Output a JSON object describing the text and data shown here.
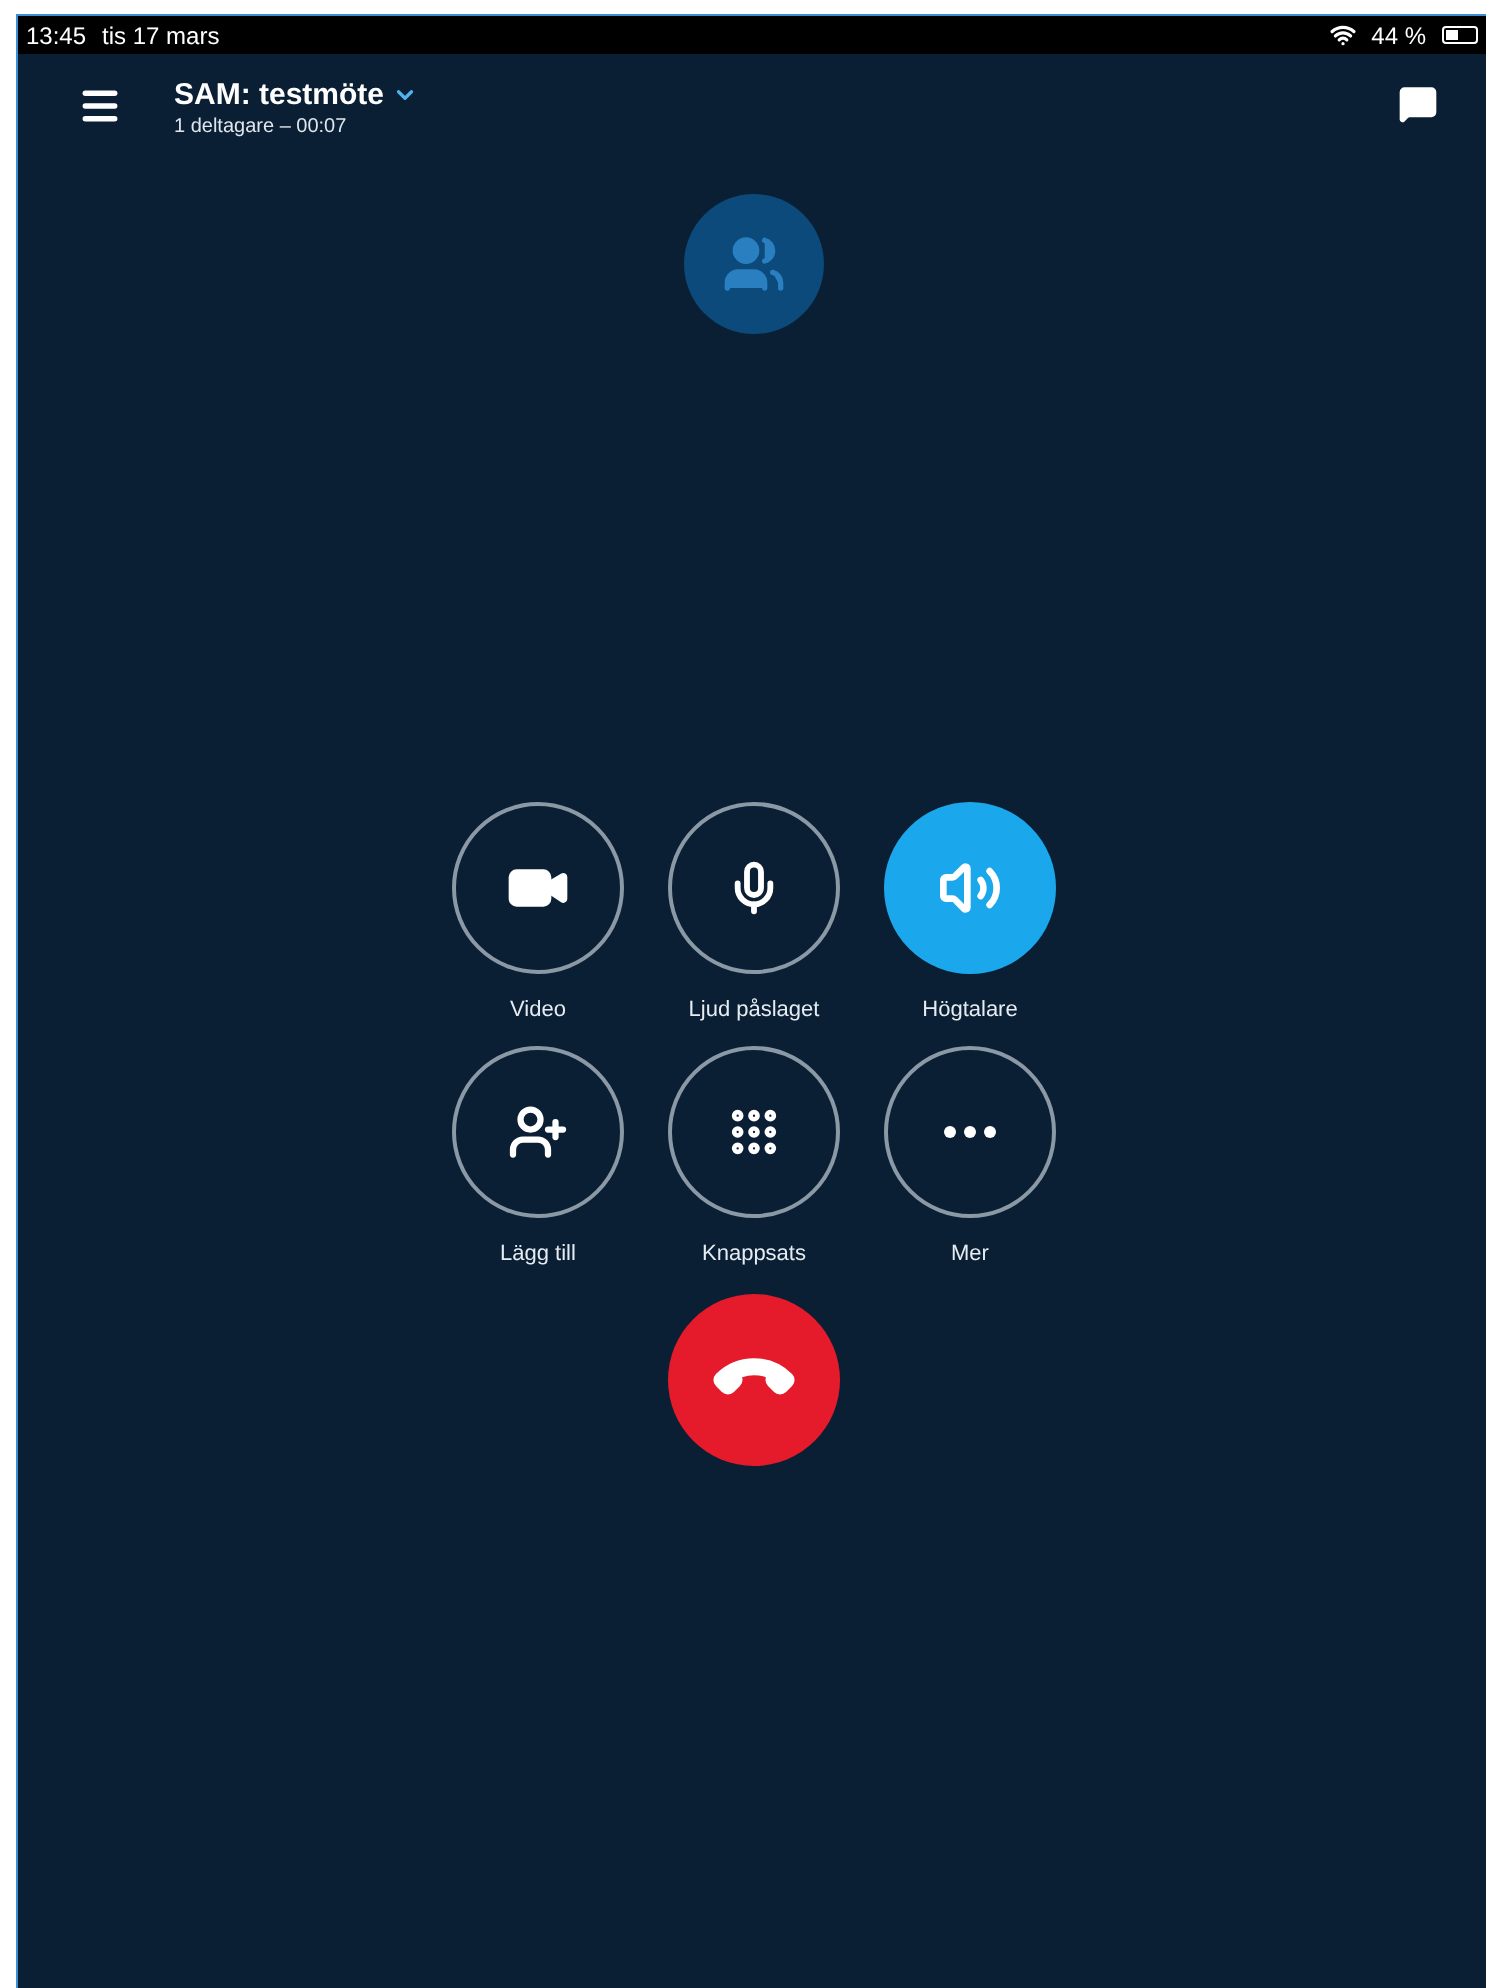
{
  "status_bar": {
    "time": "13:45",
    "date": "tis 17 mars",
    "battery": "44 %"
  },
  "header": {
    "title": "SAM: testmöte",
    "subtitle": "1 deltagare – 00:07"
  },
  "controls": [
    {
      "kind": "video",
      "label": "Video",
      "on": false
    },
    {
      "kind": "mic",
      "label": "Ljud påslaget",
      "on": false
    },
    {
      "kind": "speaker",
      "label": "Högtalare",
      "on": true
    },
    {
      "kind": "add",
      "label": "Lägg till",
      "on": false
    },
    {
      "kind": "dialpad",
      "label": "Knappsats",
      "on": false
    },
    {
      "kind": "more",
      "label": "Mer",
      "on": false
    }
  ]
}
